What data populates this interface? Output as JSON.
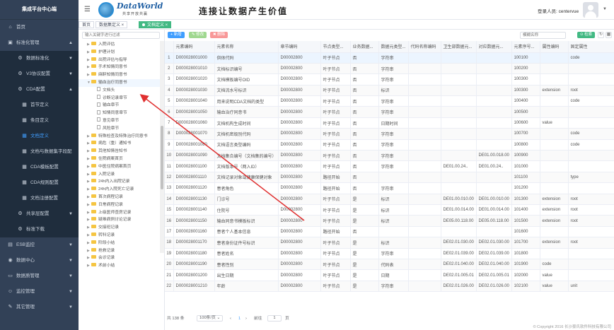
{
  "sidebar": {
    "brand": "集成平台中心端",
    "items": [
      {
        "icon": "home-icon",
        "glyph": "⌂",
        "label": "首页",
        "arrow": ""
      },
      {
        "icon": "folder-icon",
        "glyph": "▣",
        "label": "标准化管理",
        "arrow": "▲"
      },
      {
        "icon": "gear-icon",
        "glyph": "⚙",
        "label": "数据标准化",
        "arrow": "▼",
        "level": "sub"
      },
      {
        "icon": "gear-icon",
        "glyph": "⚙",
        "label": "V3协议配置",
        "arrow": "▼",
        "level": "sub"
      },
      {
        "icon": "gear-icon",
        "glyph": "⚙",
        "label": "CDA配置",
        "arrow": "▲",
        "level": "sub"
      },
      {
        "icon": "grid-icon",
        "glyph": "▦",
        "label": "首节定义",
        "arrow": "",
        "level": "subsub"
      },
      {
        "icon": "grid-icon",
        "glyph": "▦",
        "label": "条目定义",
        "arrow": "",
        "level": "subsub"
      },
      {
        "icon": "grid-icon",
        "glyph": "▦",
        "label": "文档定义",
        "arrow": "",
        "level": "subsub",
        "active": true
      },
      {
        "icon": "grid-icon",
        "glyph": "▦",
        "label": "文档与数据集字段配",
        "arrow": "",
        "level": "subsub"
      },
      {
        "icon": "grid-icon",
        "glyph": "▦",
        "label": "CDA模板配置",
        "arrow": "",
        "level": "subsub"
      },
      {
        "icon": "grid-icon",
        "glyph": "▦",
        "label": "CDA规则配置",
        "arrow": "",
        "level": "subsub"
      },
      {
        "icon": "grid-icon",
        "glyph": "▦",
        "label": "文档注册配置",
        "arrow": "",
        "level": "subsub"
      },
      {
        "icon": "gear-icon",
        "glyph": "⚙",
        "label": "共享层配置",
        "arrow": "▼",
        "level": "sub"
      },
      {
        "icon": "gear-icon",
        "glyph": "⚙",
        "label": "标准下载",
        "arrow": "",
        "level": "sub"
      },
      {
        "icon": "chart-icon",
        "glyph": "▤",
        "label": "ESB监控",
        "arrow": "▼"
      },
      {
        "icon": "database-icon",
        "glyph": "◉",
        "label": "数据中心",
        "arrow": "▼"
      },
      {
        "icon": "monitor-icon",
        "glyph": "▭",
        "label": "数据质管理",
        "arrow": "▼"
      },
      {
        "icon": "user-icon",
        "glyph": "☺",
        "label": "监控管理",
        "arrow": "▼"
      },
      {
        "icon": "wrench-icon",
        "glyph": "✎",
        "label": "其它管理",
        "arrow": "▼"
      }
    ]
  },
  "header": {
    "logo_text": "DataWorld",
    "logo_sub": "共享开放共赢",
    "slogan": "连接让数据产生价值",
    "login_label": "登录人员: centervue"
  },
  "tabs": [
    {
      "label": "首页",
      "active": false
    },
    {
      "label": "数据集定义",
      "active": false,
      "closable": true
    },
    {
      "label": "文档定义",
      "active": true,
      "closable": true
    }
  ],
  "tree": {
    "search_placeholder": "输入关键字进行过滤",
    "nodes": [
      {
        "label": "入院评估",
        "level": 0,
        "folder": true
      },
      {
        "label": "护理计划",
        "level": 0,
        "folder": true
      },
      {
        "label": "出院评估与指导",
        "level": 0,
        "folder": true
      },
      {
        "label": "手术知情同意书",
        "level": 0,
        "folder": true
      },
      {
        "label": "麻醉知情同意书",
        "level": 0,
        "folder": true
      },
      {
        "label": "输血治疗同意书",
        "level": 0,
        "folder": true,
        "expanded": true,
        "highlight": true
      },
      {
        "label": "文档头",
        "level": 1,
        "folder": false
      },
      {
        "label": "诊断记录章节",
        "level": 1,
        "folder": false
      },
      {
        "label": "输血章节",
        "level": 1,
        "folder": false
      },
      {
        "label": "知情同意章节",
        "level": 1,
        "folder": false
      },
      {
        "label": "意见章节",
        "level": 1,
        "folder": false
      },
      {
        "label": "风险章节",
        "level": 1,
        "folder": false
      },
      {
        "label": "特殊检查及特殊治疗同意书",
        "level": 0,
        "folder": true
      },
      {
        "label": "病危（重）通知书",
        "level": 0,
        "folder": true
      },
      {
        "label": "其他知情告知书",
        "level": 0,
        "folder": true
      },
      {
        "label": "住院病案首页",
        "level": 0,
        "folder": true
      },
      {
        "label": "中医住院病案首页",
        "level": 0,
        "folder": true
      },
      {
        "label": "入院记录",
        "level": 0,
        "folder": true
      },
      {
        "label": "24h内入出院记录",
        "level": 0,
        "folder": true
      },
      {
        "label": "24h内入院死亡记录",
        "level": 0,
        "folder": true
      },
      {
        "label": "首次病程记录",
        "level": 0,
        "folder": true
      },
      {
        "label": "日常病程记录",
        "level": 0,
        "folder": true
      },
      {
        "label": "上级医师查房记录",
        "level": 0,
        "folder": true
      },
      {
        "label": "疑难病例讨论记录",
        "level": 0,
        "folder": true
      },
      {
        "label": "交接班记录",
        "level": 0,
        "folder": true
      },
      {
        "label": "转科记录",
        "level": 0,
        "folder": true
      },
      {
        "label": "阶段小结",
        "level": 0,
        "folder": true
      },
      {
        "label": "抢救记录",
        "level": 0,
        "folder": true
      },
      {
        "label": "会诊记录",
        "level": 0,
        "folder": true
      },
      {
        "label": "术前小结",
        "level": 0,
        "folder": true
      }
    ]
  },
  "toolbar": {
    "add_label": "+ 新增",
    "edit_label": "✎ 修改",
    "delete_label": "✖ 删除",
    "filter_placeholder": "模糊名称",
    "search_label": "⊙ 检索"
  },
  "table": {
    "columns": [
      "",
      "元素编码",
      "元素名称",
      "章节编码",
      "节点类型...",
      "业务数据...",
      "数据元类型...",
      "代码名称编码",
      "卫生部数据元...",
      "对应数据元...",
      "元素序号...",
      "属性编码",
      "固定属性"
    ],
    "rows": [
      [
        "1",
        "D000028001000",
        "供体代码",
        "D00002800",
        "叶子节点",
        "否",
        "字符串",
        "",
        "",
        "",
        "100100",
        "",
        "code"
      ],
      [
        "2",
        "D000028001010",
        "文档标识编号",
        "D00002800",
        "叶子节点",
        "否",
        "字符串",
        "",
        "",
        "",
        "100200",
        "",
        ""
      ],
      [
        "3",
        "D000028001020",
        "文档模板编号OID",
        "D00002800",
        "叶子节点",
        "否",
        "字符串",
        "",
        "",
        "",
        "100300",
        "",
        ""
      ],
      [
        "4",
        "D000028001030",
        "文档流水号标识",
        "D00002800",
        "叶子节点",
        "否",
        "标识",
        "",
        "",
        "",
        "100300",
        "extension",
        "root"
      ],
      [
        "5",
        "D000028001040",
        "用来说明CDA文档的类型",
        "D00002800",
        "叶子节点",
        "否",
        "字符串",
        "",
        "",
        "",
        "100400",
        "",
        "code"
      ],
      [
        "6",
        "D000028001050",
        "输血治疗同意书",
        "D00002800",
        "叶子节点",
        "否",
        "字符串",
        "",
        "",
        "",
        "100500",
        "",
        ""
      ],
      [
        "7",
        "D000028001060",
        "文档机构生成时间",
        "D00002800",
        "叶子节点",
        "否",
        "日期时间",
        "",
        "",
        "",
        "100600",
        "value",
        ""
      ],
      [
        "8",
        "D000028001070",
        "文档机密级别代码",
        "D00002800",
        "叶子节点",
        "否",
        "字符串",
        "",
        "",
        "",
        "100700",
        "",
        "code"
      ],
      [
        "9",
        "D000028001080",
        "文档语言类型编码",
        "D00002800",
        "叶子节点",
        "否",
        "字符串",
        "",
        "",
        "",
        "100800",
        "",
        "code"
      ],
      [
        "10",
        "D000028001090",
        "文档集合编号（文档集的编号）",
        "D00002800",
        "叶子节点",
        "否",
        "字符串",
        "",
        "",
        "DE01.00.018.00",
        "100900",
        "",
        ""
      ],
      [
        "11",
        "D000028001100",
        "文档版本号（两入ID）",
        "D00002800",
        "叶子节点",
        "否",
        "字符串",
        "",
        "DE01.00.24..",
        "DE01.00.24..",
        "101000",
        "",
        ""
      ],
      [
        "12",
        "D000028001110",
        "文档记录对象或健康保健对象",
        "D00002800",
        "路径开始",
        "否",
        "",
        "",
        "",
        "",
        "101100",
        "",
        "type"
      ],
      [
        "13",
        "D000028001120",
        "患者角色",
        "D00002800",
        "路径开始",
        "否",
        "字符串",
        "",
        "",
        "",
        "101200",
        "",
        ""
      ],
      [
        "14",
        "D000028001130",
        "门诊号",
        "D00002800",
        "叶子节点",
        "是",
        "标识",
        "",
        "DE01.00.010.00",
        "DE01.00.010.00",
        "101300",
        "extension",
        "root"
      ],
      [
        "15",
        "D000028001140",
        "住院号",
        "D00002800",
        "叶子节点",
        "是",
        "标识",
        "",
        "DE01.00.014.00",
        "DE01.00.014.00",
        "101400",
        "extension",
        "root"
      ],
      [
        "16",
        "D000028001150",
        "输血同意书模板标识",
        "D00002800",
        "叶子节点",
        "是",
        "标识",
        "",
        "DE05.00.118.00",
        "DE05.00.118.00",
        "101500",
        "extension",
        "root"
      ],
      [
        "17",
        "D000028001160",
        "患者个人基本信息",
        "D00002800",
        "路径开始",
        "否",
        "",
        "",
        "",
        "",
        "101600",
        "",
        ""
      ],
      [
        "18",
        "D000028001170",
        "患者身份证件号标识",
        "D00002800",
        "叶子节点",
        "是",
        "标识",
        "",
        "DE02.01.030.00",
        "DE02.01.030.00",
        "101700",
        "extension",
        "root"
      ],
      [
        "19",
        "D000028001180",
        "患者姓名",
        "D00002800",
        "叶子节点",
        "是",
        "字符串",
        "",
        "DE02.01.039.00",
        "DE02.01.039.00",
        "101800",
        "",
        ""
      ],
      [
        "20",
        "D000028001190",
        "患者性别",
        "D00002800",
        "叶子节点",
        "是",
        "代码表",
        "",
        "DE02.01.040.00",
        "DE02.01.040.00",
        "101900",
        "code",
        ""
      ],
      [
        "21",
        "D000028001200",
        "出生日期",
        "D00002800",
        "叶子节点",
        "是",
        "日期",
        "",
        "DE02.01.005.01",
        "DE02.01.005.01",
        "102000",
        "value",
        ""
      ],
      [
        "22",
        "D000028001210",
        "年龄",
        "D00002800",
        "叶子节点",
        "是",
        "字符串",
        "",
        "DE02.01.026.00",
        "DE02.01.026.00",
        "102100",
        "value",
        "unit"
      ]
    ]
  },
  "pager": {
    "total": "共 138 条",
    "page_size": "100条/页",
    "prev": "‹",
    "current": "1",
    "next": "›",
    "goto_label": "前往",
    "goto_value": "1",
    "goto_suffix": "页"
  },
  "footer": {
    "copyright": "© Copyright 2016 长沙豪氏软件科技有限公司"
  },
  "colors": {
    "sidebar_bg": "#324157",
    "accent": "#409eff",
    "success": "#42b983",
    "arrow": "#e03030"
  }
}
